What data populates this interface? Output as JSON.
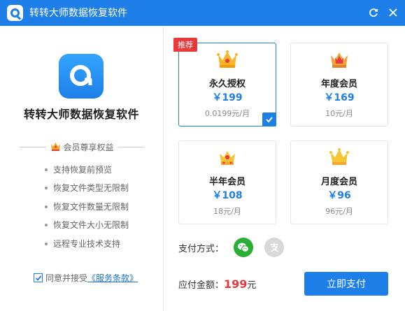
{
  "window": {
    "title": "转转大师数据恢复软件"
  },
  "left": {
    "app_name": "转转大师数据恢复软件",
    "benefits_title": "会员尊享权益",
    "benefits": [
      "支持恢复前预览",
      "恢复文件类型无限制",
      "恢复文件数量无限制",
      "恢复文件大小无限制",
      "远程专业技术支持"
    ],
    "agree_text": "同意并接受",
    "terms_link": "《服务条款》",
    "agree_checked": true
  },
  "plans": [
    {
      "name": "永久授权",
      "price": "￥199",
      "sub": "0.0199元/月",
      "badge": "推荐",
      "selected": true
    },
    {
      "name": "年度会员",
      "price": "￥169",
      "sub": "10元/月",
      "selected": false
    },
    {
      "name": "半年会员",
      "price": "￥108",
      "sub": "18元/月",
      "selected": false
    },
    {
      "name": "月度会员",
      "price": "￥96",
      "sub": "96元/月",
      "selected": false
    }
  ],
  "payment": {
    "label": "支付方式：",
    "methods": [
      "wechat-pay",
      "alipay"
    ],
    "selected": "wechat-pay"
  },
  "total": {
    "label": "应付金额：",
    "amount": "199",
    "unit": "元"
  },
  "pay_button": "立即支付",
  "colors": {
    "primary": "#1f7fe8",
    "badge": "#e8393b",
    "wechat": "#2aae36",
    "alipay_inactive": "#d9d9d9"
  }
}
